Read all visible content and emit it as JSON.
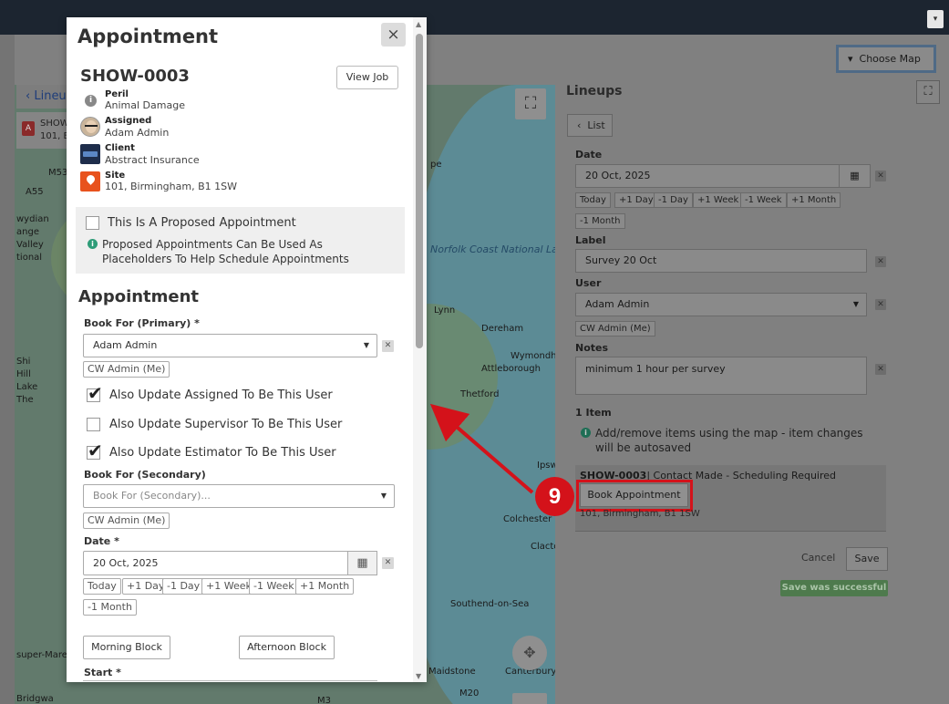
{
  "topbar": {
    "caret": "▾"
  },
  "background": {
    "left_back_label": "Lineu",
    "left_item_badge": "A",
    "left_item_line1": "SHOW",
    "left_item_line2": "101, Bi",
    "map_labels": [
      "M53",
      "A55",
      "wydian",
      "ange",
      "Valley",
      "tional",
      "Shi",
      "Hill",
      "Lake",
      "The",
      "super-Mare",
      "Norfolk Coast National Landscape",
      "pe",
      "Lynn",
      "Dereham",
      "Wymondh",
      "Attleborough",
      "Ipswich",
      "Thetford",
      "Colchester",
      "Clacton-",
      "Southend-on-Sea",
      "Maidstone",
      "Canterbury",
      "M20",
      "M3",
      "Bridgwa"
    ]
  },
  "choose_map": {
    "label": "Choose Map",
    "caret": "▾"
  },
  "lineups": {
    "title": "Lineups",
    "list_button": "List",
    "date_label": "Date",
    "date_value": "20 Oct, 2025",
    "date_chips": [
      "Today",
      "+1 Day",
      "-1 Day",
      "+1 Week",
      "-1 Week",
      "+1 Month",
      "-1 Month"
    ],
    "label_label": "Label",
    "label_value": "Survey 20 Oct",
    "user_label": "User",
    "user_value": "Adam Admin",
    "user_chip": "CW Admin (Me)",
    "notes_label": "Notes",
    "notes_value": "minimum 1 hour per survey",
    "items_count": "1 Item",
    "items_info": "Add/remove items using the map - item changes will be autosaved",
    "item_id": "SHOW-0003",
    "item_status": "| Contact Made - Scheduling Required",
    "book_button": "Book Appointment",
    "item_address": "101, Birmingham, B1 1SW",
    "cancel": "Cancel",
    "save": "Save",
    "success": "Save was successful"
  },
  "modal": {
    "title": "Appointment",
    "close": "×",
    "job_id": "SHOW-0003",
    "view_job": "View Job",
    "meta": [
      {
        "label": "Peril",
        "value": "Animal Damage",
        "icon": "info-icon"
      },
      {
        "label": "Assigned",
        "value": "Adam Admin",
        "icon": "avatar-icon"
      },
      {
        "label": "Client",
        "value": "Abstract Insurance",
        "icon": "client-logo-icon"
      },
      {
        "label": "Site",
        "value": "101, Birmingham, B1 1SW",
        "icon": "map-pin-icon"
      }
    ],
    "proposed_label": "This Is A Proposed Appointment",
    "proposed_hint": "Proposed Appointments Can Be Used As Placeholders To Help Schedule Appointments",
    "section_title": "Appointment",
    "book_primary_label": "Book For (Primary) *",
    "book_primary_value": "Adam Admin",
    "cw_admin_chip": "CW Admin (Me)",
    "update_assigned": "Also Update Assigned To Be This User",
    "update_supervisor": "Also Update Supervisor To Be This User",
    "update_estimator": "Also Update Estimator To Be This User",
    "book_secondary_label": "Book For (Secondary)",
    "book_secondary_placeholder": "Book For (Secondary)...",
    "date_label": "Date *",
    "date_value": "20 Oct, 2025",
    "date_chips": [
      "Today",
      "+1 Day",
      "-1 Day",
      "+1 Week",
      "-1 Week",
      "+1 Month",
      "-1 Month"
    ],
    "morning_block": "Morning Block",
    "afternoon_block": "Afternoon Block",
    "start_label": "Start *"
  },
  "annotation": {
    "step": "9",
    "color": "#d4121a"
  },
  "colors": {
    "topbar": "#1c2530",
    "modal_bg": "#ffffff",
    "accent_red": "#d4121a",
    "success_green": "#4e7a4d"
  }
}
